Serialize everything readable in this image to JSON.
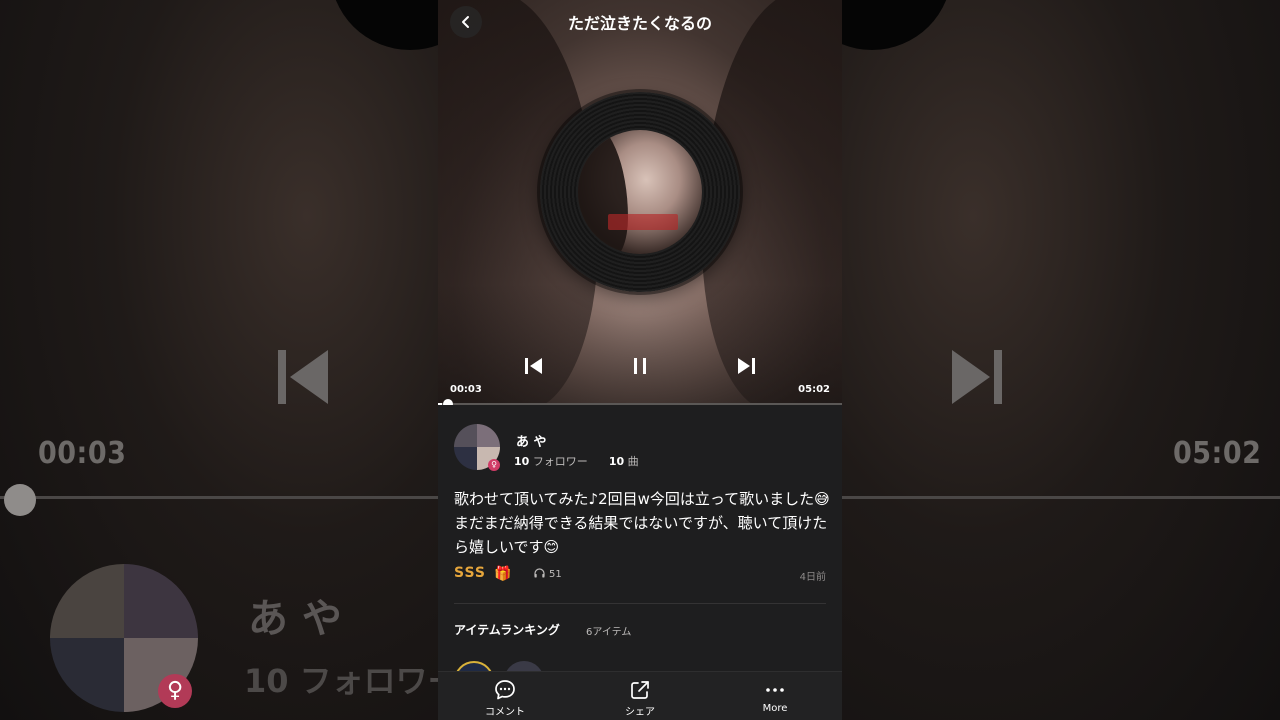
{
  "player": {
    "title": "ただ泣きたくなるの",
    "current_time": "00:03",
    "total_time": "05:02",
    "progress": 0.01
  },
  "user": {
    "name": "あ や",
    "followers_count": "10",
    "followers_label": "フォロワー",
    "songs_count": "10",
    "songs_label": "曲"
  },
  "post": {
    "description": "歌わせて頂いてみた♪2回目w今回は立って歌いました😅まだまだ納得できる結果ではないですが、聴いて頂けたら嬉しいです😊",
    "rank_badge": "SSS",
    "gift_icon": "🎁",
    "listen_count": "51",
    "posted_ago": "4日前"
  },
  "ranking": {
    "title": "アイテムランキング",
    "count": "6アイテム"
  },
  "tabbar": {
    "comment_label": "コメント",
    "share_label": "シェア",
    "more_label": "More"
  },
  "icons": {
    "back": "chevron-left-icon",
    "prev": "skip-previous-icon",
    "pause": "pause-icon",
    "next": "skip-next-icon",
    "headphones": "headphones-icon",
    "comment": "comment-bubble-icon",
    "share": "share-icon",
    "more": "more-dots-icon"
  },
  "colors": {
    "rank_gold": "#e6a63c",
    "gender_badge": "#d03c67",
    "background": "#1e1e1f"
  }
}
